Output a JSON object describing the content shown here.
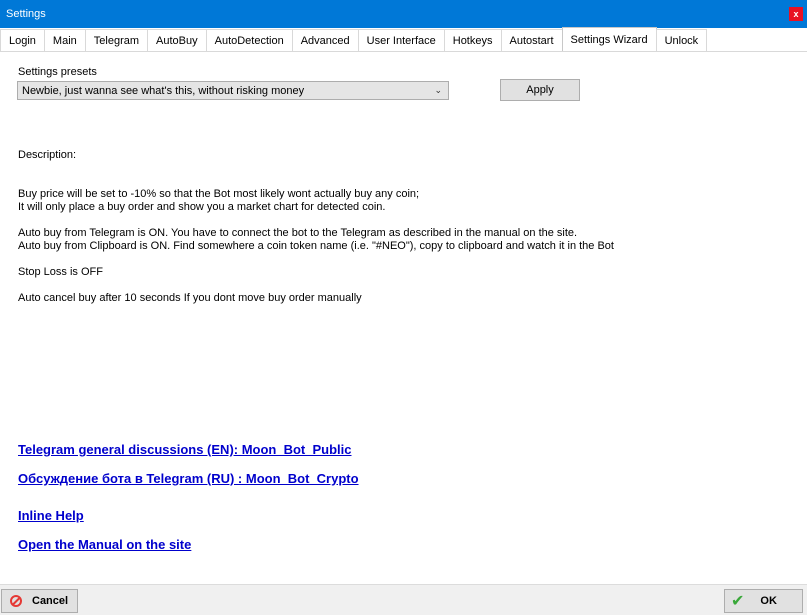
{
  "window": {
    "title": "Settings",
    "close_label": "x"
  },
  "tabs": [
    {
      "label": "Login"
    },
    {
      "label": "Main"
    },
    {
      "label": "Telegram"
    },
    {
      "label": "AutoBuy"
    },
    {
      "label": "AutoDetection"
    },
    {
      "label": "Advanced"
    },
    {
      "label": "User Interface"
    },
    {
      "label": "Hotkeys"
    },
    {
      "label": "Autostart"
    },
    {
      "label": "Settings Wizard",
      "active": true
    },
    {
      "label": "Unlock"
    }
  ],
  "presets": {
    "label": "Settings presets",
    "selected": "Newbie, just wanna see what's this, without risking money",
    "apply_label": "Apply"
  },
  "description": {
    "heading": "Description:",
    "line1": "Buy price will be set to -10% so that the Bot most likely wont actually buy any coin;",
    "line2": "It will only place a buy order and show you a market chart for detected coin.",
    "line3": "Auto buy from Telegram is ON. You have to connect the bot to the Telegram as described in the manual on the site.",
    "line4": "Auto buy from Clipboard is ON. Find somewhere a coin token name (i.e. \"#NEO\"), copy to clipboard and watch it in the Bot",
    "line5": "Stop Loss is OFF",
    "line6": "Auto cancel buy after 10 seconds If you dont move buy order manually"
  },
  "links": {
    "telegram_en": "Telegram general discussions (EN): Moon_Bot_Public",
    "telegram_ru": "Обсуждение бота в Telegram (RU) : Moon_Bot_Crypto",
    "inline_help": "Inline Help",
    "manual": "Open the Manual on the site"
  },
  "footer": {
    "cancel_label": "Cancel",
    "ok_label": "OK"
  }
}
